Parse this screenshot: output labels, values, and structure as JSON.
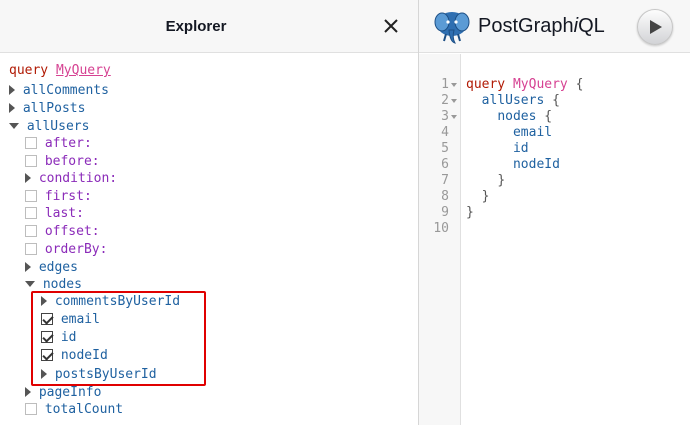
{
  "explorer": {
    "title": "Explorer",
    "query_keyword": "query",
    "operation_name": "MyQuery",
    "tree": {
      "allComments": "allComments",
      "allPosts": "allPosts",
      "allUsers": "allUsers",
      "after": "after:",
      "before": "before:",
      "condition": "condition:",
      "first": "first:",
      "last": "last:",
      "offset": "offset:",
      "orderBy": "orderBy:",
      "edges": "edges",
      "nodes": "nodes",
      "commentsByUserId": "commentsByUserId",
      "email": "email",
      "id": "id",
      "nodeId": "nodeId",
      "postsByUserId": "postsByUserId",
      "pageInfo": "pageInfo",
      "totalCount": "totalCount"
    },
    "checked": {
      "email": true,
      "id": true,
      "nodeId": true
    }
  },
  "app": {
    "title_prefix": "PostGraph",
    "title_italic": "i",
    "title_suffix": "QL",
    "logo_icon": "elephant-logo-icon",
    "run_icon": "play-icon"
  },
  "editor": {
    "line_numbers": [
      "1",
      "2",
      "3",
      "4",
      "5",
      "6",
      "7",
      "8",
      "9",
      "10"
    ],
    "query_keyword": "query",
    "operation_name": "MyQuery",
    "lines": {
      "l1_brace": " {",
      "l2_field": "allUsers",
      "l2_brace": " {",
      "l3_field": "nodes",
      "l3_brace": " {",
      "l4_field": "email",
      "l5_field": "id",
      "l6_field": "nodeId",
      "l7": "}",
      "l8": "}",
      "l9": "}"
    }
  },
  "colors": {
    "keyword": "#b11a04",
    "operation": "#d64292",
    "field": "#1f61a0",
    "argument": "#8b2bb9",
    "highlight_border": "#e00000"
  }
}
